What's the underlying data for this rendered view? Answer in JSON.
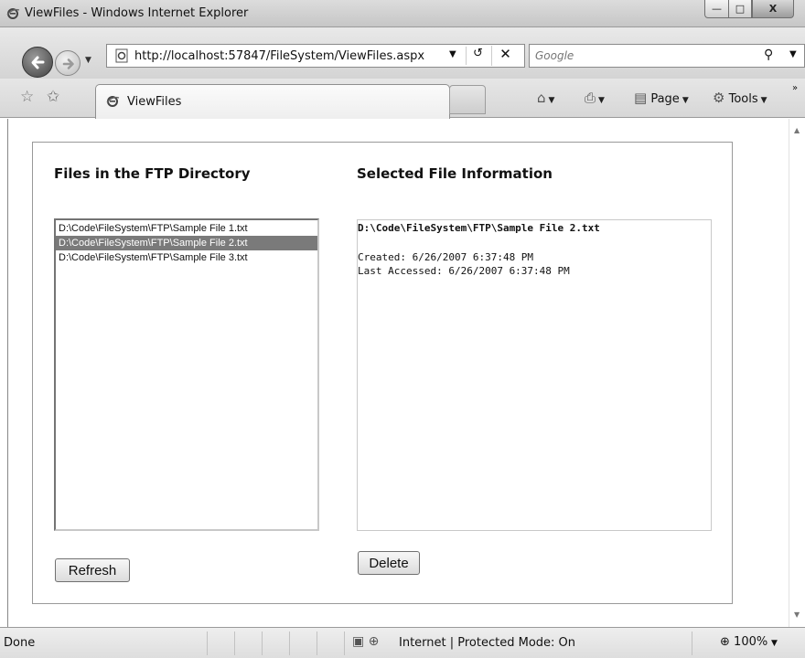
{
  "window": {
    "title": "ViewFiles - Windows Internet Explorer",
    "minimize_glyph": "—",
    "maximize_glyph": "□",
    "close_glyph": "X"
  },
  "address": {
    "url": "http://localhost:57847/FileSystem/ViewFiles.aspx",
    "search_placeholder": "Google"
  },
  "tabs": [
    {
      "label": "ViewFiles",
      "active": true
    }
  ],
  "command_bar": {
    "page_label": "Page",
    "tools_label": "Tools"
  },
  "left_panel": {
    "heading": "Files in the FTP Directory",
    "files": [
      {
        "path": "D:\\Code\\FileSystem\\FTP\\Sample File 1.txt",
        "selected": false
      },
      {
        "path": "D:\\Code\\FileSystem\\FTP\\Sample File 2.txt",
        "selected": true
      },
      {
        "path": "D:\\Code\\FileSystem\\FTP\\Sample File 3.txt",
        "selected": false
      }
    ],
    "refresh_label": "Refresh"
  },
  "right_panel": {
    "heading": "Selected File Information",
    "file_name": "D:\\Code\\FileSystem\\FTP\\Sample File 2.txt",
    "created": "Created: 6/26/2007 6:37:48 PM",
    "last_accessed": "Last Accessed: 6/26/2007 6:37:48 PM",
    "delete_label": "Delete"
  },
  "status_bar": {
    "status": "Done",
    "zone": "Internet | Protected Mode: On",
    "zoom": "100%"
  },
  "colors": {
    "selection": "#7a7a7a",
    "chrome": "#d8d8d8"
  },
  "icons": [
    "ie-logo-icon",
    "back-arrow-icon",
    "forward-arrow-icon",
    "page-icon",
    "refresh-icon",
    "stop-icon",
    "search-icon",
    "favorites-star-icon",
    "add-favorites-icon",
    "home-icon",
    "print-icon",
    "page-menu-icon",
    "tools-gear-icon",
    "zoom-icon"
  ]
}
